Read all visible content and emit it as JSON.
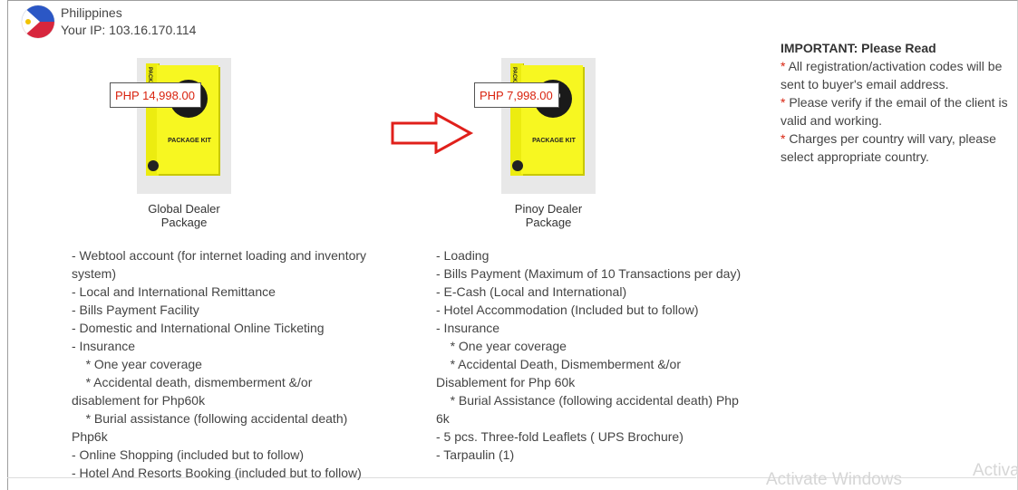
{
  "location": {
    "flag_icon": "philippines-flag-icon",
    "country": "Philippines",
    "ip_label": "Your IP: 103.16.170.114"
  },
  "packages": [
    {
      "price": "PHP 14,998.00",
      "name_line1": "Global Dealer",
      "name_line2": "Package",
      "box_label": "PACKAGE KIT",
      "box_circle_text": "IED",
      "box_spine_text": "PACKA",
      "features": [
        "- Webtool account (for internet loading and inventory",
        "system)",
        "- Local and International Remittance",
        "- Bills Payment Facility",
        "- Domestic and International Online Ticketing",
        "- Insurance",
        "    * One year coverage",
        "    * Accidental death, dismemberment &/or",
        "disablement for Php60k",
        "    * Burial assistance (following accidental death)",
        "Php6k",
        "- Online Shopping (included but to follow)",
        "- Hotel And Resorts Booking (included but to follow)"
      ]
    },
    {
      "price": "PHP 7,998.00",
      "name_line1": "Pinoy Dealer",
      "name_line2": "Package",
      "box_label": "PACKAGE KIT",
      "box_circle_text": "IED",
      "box_spine_text": "PACKA",
      "features": [
        "- Loading",
        "- Bills Payment (Maximum of 10 Transactions per day)",
        "- E-Cash (Local and International)",
        "- Hotel Accommodation (Included but to follow)",
        "- Insurance",
        "    * One year coverage",
        "    * Accidental Death, Dismemberment &/or",
        "Disablement for Php 60k",
        "    * Burial Assistance (following accidental death) Php",
        "6k",
        "- 5 pcs. Three-fold Leaflets ( UPS Brochure)",
        "- Tarpaulin (1)"
      ]
    }
  ],
  "arrow": {
    "icon": "right-arrow-icon",
    "color": "#e0201b"
  },
  "notice": {
    "title": "IMPORTANT: Please Read",
    "star": "*",
    "items": [
      "All registration/activation codes will be sent to buyer's email address.",
      "Please verify if the email of the client is valid and working.",
      "Charges per country will vary, please select appropriate country."
    ]
  },
  "watermark": {
    "text1": "Activate Windows",
    "text2": "Activa"
  },
  "colors": {
    "price_red": "#d9230f",
    "box_yellow": "#f7f721",
    "text": "#444444"
  }
}
